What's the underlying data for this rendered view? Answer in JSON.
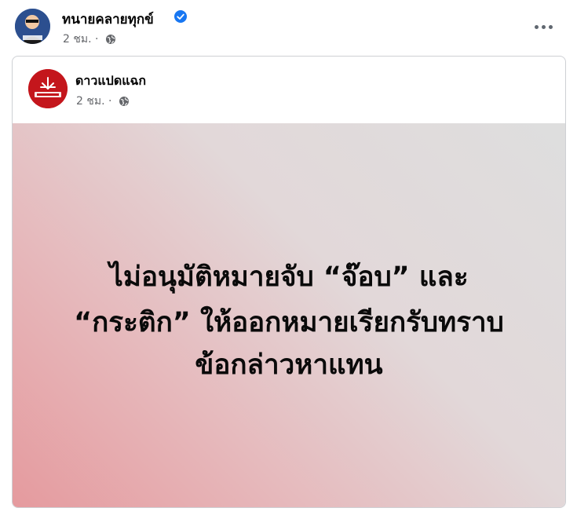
{
  "post": {
    "author_name": "ทนายคลายทุกข์",
    "time": "2 ชม. ·",
    "privacy_icon": "globe-icon",
    "more_icon": "more-options-icon"
  },
  "shared_post": {
    "page_name": "ดาวแปดแฉก",
    "time": "2 ชม. ·",
    "privacy_icon": "globe-icon",
    "image_text": {
      "line1": "ไม่อนุมัติหมายจับ “จ๊อบ” และ",
      "line2": "“กระติก” ให้ออกหมายเรียกรับทราบ",
      "line3": "ข้อกล่าวหาแทน"
    }
  },
  "colors": {
    "verified": "#1877f2",
    "meta_text": "#65676b",
    "page_avatar_bg": "#c4161c"
  }
}
